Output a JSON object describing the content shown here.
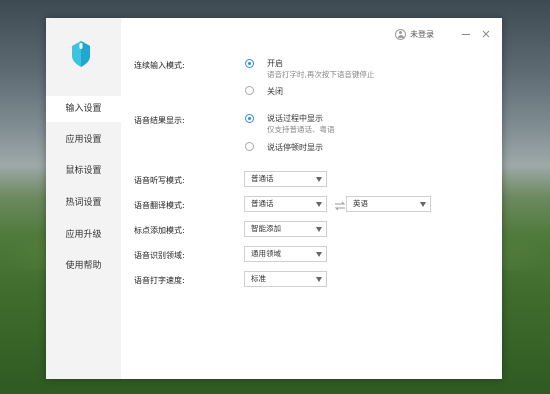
{
  "titlebar": {
    "login_label": "未登录"
  },
  "sidebar": {
    "items": [
      {
        "label": "输入设置",
        "active": true
      },
      {
        "label": "应用设置",
        "active": false
      },
      {
        "label": "鼠标设置",
        "active": false
      },
      {
        "label": "热词设置",
        "active": false
      },
      {
        "label": "应用升级",
        "active": false
      },
      {
        "label": "使用帮助",
        "active": false
      }
    ]
  },
  "settings": {
    "continuous_mode": {
      "label": "连续输入模式:",
      "options": [
        {
          "label": "开启",
          "sub": "语音打字时,再次按下语音键停止",
          "checked": true
        },
        {
          "label": "关闭",
          "checked": false
        }
      ]
    },
    "result_display": {
      "label": "语音结果显示:",
      "options": [
        {
          "label": "说话过程中显示",
          "sub": "仅支持普通话、粤语",
          "checked": true
        },
        {
          "label": "说话停顿时显示",
          "checked": false
        }
      ]
    },
    "dictation_mode": {
      "label": "语音听写模式:",
      "value": "普通话"
    },
    "translation_mode": {
      "label": "语音翻译模式:",
      "from": "普通话",
      "to": "英语"
    },
    "punctuation_mode": {
      "label": "标点添加模式:",
      "value": "智能添加"
    },
    "recognition_domain": {
      "label": "语音识别领域:",
      "value": "通用领域"
    },
    "typing_speed": {
      "label": "语音打字速度:",
      "value": "标准"
    }
  },
  "colors": {
    "accent": "#2f8ee0",
    "sidebar_bg": "#f3f3f3",
    "logo": "#3cc3e0"
  }
}
